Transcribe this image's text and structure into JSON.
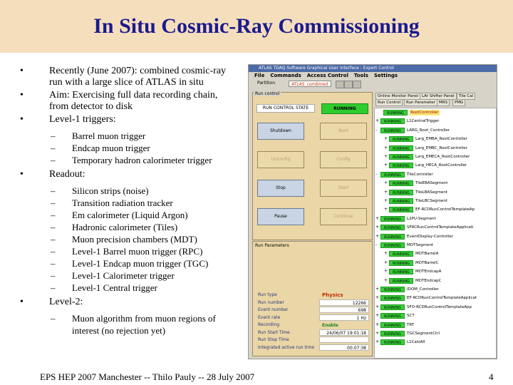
{
  "title": "In Situ Cosmic-Ray Commissioning",
  "bullets": [
    {
      "dot": "•",
      "text": "Recently (June 2007): combined cosmic-ray run with a large slice of ATLAS in situ",
      "subs": []
    },
    {
      "dot": "•",
      "text": "Aim: Exercising full data recording chain, from detector to disk",
      "subs": []
    },
    {
      "dot": "•",
      "text": "Level-1 triggers:",
      "subs": [
        "Barrel muon trigger",
        "Endcap muon trigger",
        "Temporary hadron calorimeter trigger"
      ]
    },
    {
      "dot": "•",
      "text": "Readout:",
      "subs": [
        "Silicon strips (noise)",
        "Transition radiation tracker",
        "Em calorimeter (Liquid Argon)",
        "Hadronic calorimeter (Tiles)",
        "Muon precision chambers (MDT)",
        "Level-1 Barrel muon trigger (RPC)",
        "Level-1 Endcap muon trigger (TGC)",
        "Level-1 Calorimeter trigger",
        "Level-1 Central trigger"
      ]
    },
    {
      "dot": "•",
      "text": "Level-2:",
      "subs": [
        "Muon algorithm from muon regions of interest (no rejection yet)"
      ]
    }
  ],
  "dash": "–",
  "gui": {
    "window_title": "ATLAS TDAQ Software Graphical User Interface : Expert Control",
    "menu": [
      "File",
      "Commands",
      "Access Control",
      "Tools",
      "Settings"
    ],
    "partition_label": "Partition",
    "partition_value": "ATLAS_combined",
    "run_control": {
      "header": "Run control",
      "state_label": "RUN CONTROL STATE",
      "state_value": "RUNNING",
      "buttons": [
        {
          "label": "Shutdown",
          "active": true
        },
        {
          "label": "Boot",
          "active": false
        },
        {
          "label": "Unconfig",
          "active": false
        },
        {
          "label": "Config",
          "active": false
        },
        {
          "label": "Stop",
          "active": true
        },
        {
          "label": "Start",
          "active": false
        },
        {
          "label": "Pause",
          "active": true
        },
        {
          "label": "Continue",
          "active": false
        }
      ]
    },
    "run_params": {
      "header": "Run Parameters",
      "rows": [
        {
          "key": "Run type",
          "value": "Physics",
          "style": "red"
        },
        {
          "key": "Run number",
          "value": "12266",
          "style": "box"
        },
        {
          "key": "Event number",
          "value": "698",
          "style": "box"
        },
        {
          "key": "Event rate",
          "value": "1 Hz",
          "style": "box"
        },
        {
          "key": "Recording",
          "value": "Enable",
          "style": "green"
        },
        {
          "key": "Run Start Time",
          "value": "24/06/07 19:01:18",
          "style": "box"
        },
        {
          "key": "Run Stop Time",
          "value": "",
          "style": "box"
        },
        {
          "key": "Integrated active run time",
          "value": "00:07:38",
          "style": "box"
        }
      ]
    },
    "tabs_row1": [
      "Online Monitor Panel",
      "LAr Shifter Panel",
      "Tile Cal"
    ],
    "tabs_row2": [
      "Run Control",
      "Run Parameter",
      "MRS",
      "PMG"
    ],
    "tree": [
      {
        "state": "RUNNING",
        "name": "RootController",
        "root": true,
        "indent": 0,
        "expand": ""
      },
      {
        "state": "RUNNING",
        "name": "L1CentralTrigger",
        "root": false,
        "indent": 1,
        "expand": "+"
      },
      {
        "state": "RUNNING",
        "name": "LARG_Root_Controller",
        "root": false,
        "indent": 1,
        "expand": "-"
      },
      {
        "state": "RUNNING",
        "name": "Larg_EMBA_RootController",
        "root": false,
        "indent": 2,
        "expand": "+"
      },
      {
        "state": "RUNNING",
        "name": "Larg_EMBC_RootController",
        "root": false,
        "indent": 2,
        "expand": "+"
      },
      {
        "state": "RUNNING",
        "name": "Larg_EMECA_RootController",
        "root": false,
        "indent": 2,
        "expand": "+"
      },
      {
        "state": "RUNNING",
        "name": "Larg_HECA_RootController",
        "root": false,
        "indent": 2,
        "expand": "+"
      },
      {
        "state": "RUNNING",
        "name": "TileController",
        "root": false,
        "indent": 1,
        "expand": "-"
      },
      {
        "state": "RUNNING",
        "name": "TileEBASegment",
        "root": false,
        "indent": 2,
        "expand": "+"
      },
      {
        "state": "RUNNING",
        "name": "TileLBASegment",
        "root": false,
        "indent": 2,
        "expand": "+"
      },
      {
        "state": "RUNNING",
        "name": "TileLBCSegment",
        "root": false,
        "indent": 2,
        "expand": "+"
      },
      {
        "state": "RUNNING",
        "name": "EF-RCDRunControlTemplateAp",
        "root": false,
        "indent": 2,
        "expand": "+"
      },
      {
        "state": "RUNNING",
        "name": "L2PU-Segment",
        "root": false,
        "indent": 1,
        "expand": "+"
      },
      {
        "state": "RUNNING",
        "name": "SFRCRunControlTemplateApplicati",
        "root": false,
        "indent": 1,
        "expand": "+"
      },
      {
        "state": "RUNNING",
        "name": "EventDisplay-Controller",
        "root": false,
        "indent": 1,
        "expand": "+"
      },
      {
        "state": "RUNNING",
        "name": "MDTSegment",
        "root": false,
        "indent": 1,
        "expand": "-"
      },
      {
        "state": "RUNNING",
        "name": "MDTBarrelA",
        "root": false,
        "indent": 2,
        "expand": "+"
      },
      {
        "state": "RUNNING",
        "name": "MDTBarrelC",
        "root": false,
        "indent": 2,
        "expand": "+"
      },
      {
        "state": "RUNNING",
        "name": "MDTEndcapA",
        "root": false,
        "indent": 2,
        "expand": "+"
      },
      {
        "state": "RUNNING",
        "name": "MDTEndcapC",
        "root": false,
        "indent": 2,
        "expand": "+"
      },
      {
        "state": "RUNNING",
        "name": "IDOM_Controller",
        "root": false,
        "indent": 1,
        "expand": "+"
      },
      {
        "state": "RUNNING",
        "name": "EF-RCDRunControlTemplateApplicat",
        "root": false,
        "indent": 1,
        "expand": "+"
      },
      {
        "state": "RUNNING",
        "name": "SFO-RCDRunControlTemplateApp",
        "root": false,
        "indent": 1,
        "expand": "+"
      },
      {
        "state": "RUNNING",
        "name": "SCT",
        "root": false,
        "indent": 1,
        "expand": "+"
      },
      {
        "state": "RUNNING",
        "name": "TRT",
        "root": false,
        "indent": 1,
        "expand": "+"
      },
      {
        "state": "RUNNING",
        "name": "TGCSegmentCtrl",
        "root": false,
        "indent": 1,
        "expand": "+"
      },
      {
        "state": "RUNNING",
        "name": "L1CaloAll",
        "root": false,
        "indent": 1,
        "expand": "+"
      }
    ],
    "colors": {
      "running": "#38d038",
      "panel": "#ead6a6",
      "root_highlight": "#f6e87a"
    }
  },
  "footer": "EPS HEP 2007 Manchester  --  Thilo Pauly  --  28 July 2007",
  "page_number": "4"
}
